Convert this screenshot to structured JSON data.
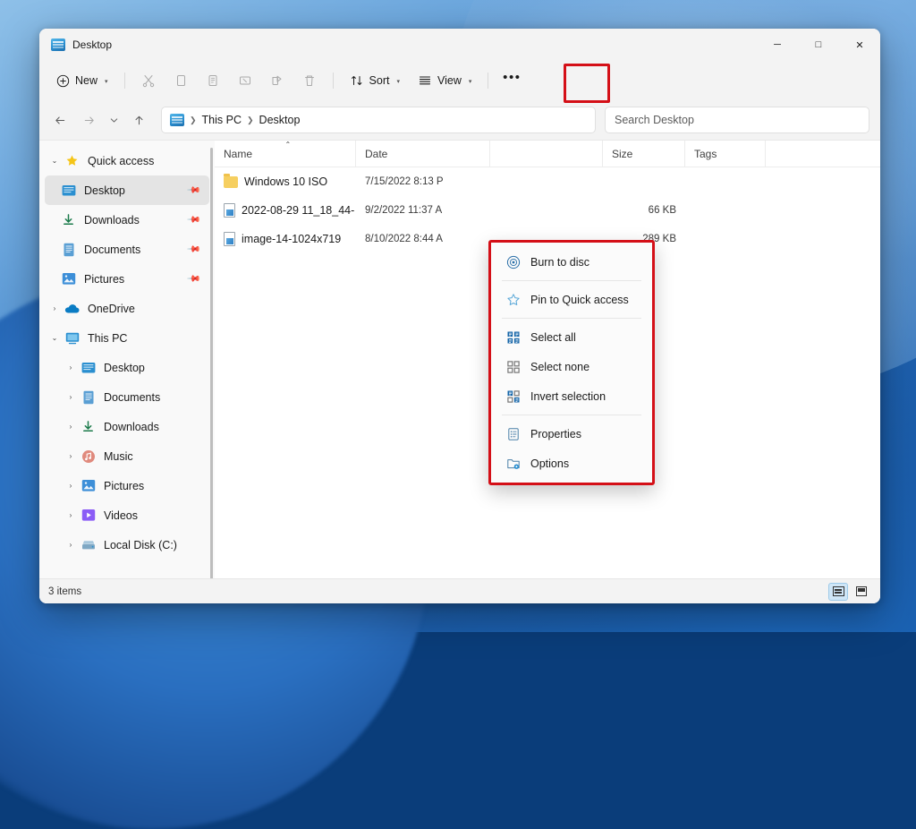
{
  "window": {
    "title": "Desktop",
    "title_icon": "desktop-icon",
    "controls": {
      "minimize": "─",
      "maximize": "□",
      "close": "✕"
    }
  },
  "toolbar": {
    "new_label": "New",
    "new_icon": "plus-circle-icon",
    "caret": "▾",
    "items": [
      {
        "name": "cut",
        "icon": "scissors-icon",
        "glyph": "✂"
      },
      {
        "name": "copy",
        "icon": "copy-icon",
        "glyph": "❐"
      },
      {
        "name": "paste",
        "icon": "paste-icon",
        "glyph": "Ὄb"
      },
      {
        "name": "rename",
        "icon": "rename-icon",
        "glyph": "✎"
      },
      {
        "name": "share",
        "icon": "share-icon",
        "glyph": "➦"
      },
      {
        "name": "delete",
        "icon": "trash-icon",
        "glyph": "Ὕ1"
      }
    ],
    "sort_label": "Sort",
    "sort_icon": "sort-arrows-icon",
    "view_label": "View",
    "view_icon": "view-lines-icon",
    "more_label": "•••",
    "more_icon": "see-more-ellipsis-icon"
  },
  "navigation": {
    "back_icon": "arrow-left-icon",
    "forward_icon": "arrow-right-icon",
    "recent_icon": "chevron-down-icon",
    "up_icon": "arrow-up-icon",
    "breadcrumb": [
      "This PC",
      "Desktop"
    ],
    "breadcrumb_separator": "❯",
    "breadcrumb_icon": "this-pc-icon"
  },
  "search": {
    "placeholder": "Search Desktop",
    "icon": "search-icon"
  },
  "sidebar": {
    "sections": [
      {
        "name": "quick-access",
        "label": "Quick access",
        "icon": "star-icon",
        "chevron": "⌄",
        "expanded": true,
        "items": [
          {
            "label": "Desktop",
            "icon": "desktop-icon",
            "pinned": true,
            "selected": true
          },
          {
            "label": "Downloads",
            "icon": "downloads-icon",
            "pinned": true,
            "selected": false
          },
          {
            "label": "Documents",
            "icon": "documents-icon",
            "pinned": true,
            "selected": false
          },
          {
            "label": "Pictures",
            "icon": "pictures-icon",
            "pinned": true,
            "selected": false
          }
        ]
      },
      {
        "name": "onedrive",
        "label": "OneDrive",
        "icon": "cloud-icon",
        "chevron": "›",
        "expanded": false,
        "items": []
      },
      {
        "name": "this-pc",
        "label": "This PC",
        "icon": "this-pc-icon",
        "chevron": "⌄",
        "expanded": true,
        "items": [
          {
            "label": "Desktop",
            "icon": "desktop-icon",
            "chevron": "›"
          },
          {
            "label": "Documents",
            "icon": "documents-icon",
            "chevron": "›"
          },
          {
            "label": "Downloads",
            "icon": "downloads-icon",
            "chevron": "›"
          },
          {
            "label": "Music",
            "icon": "music-icon",
            "chevron": "›"
          },
          {
            "label": "Pictures",
            "icon": "pictures-icon",
            "chevron": "›"
          },
          {
            "label": "Videos",
            "icon": "videos-icon",
            "chevron": "›"
          },
          {
            "label": "Local Disk (C:)",
            "icon": "drive-icon",
            "chevron": "›"
          }
        ]
      }
    ]
  },
  "filelist": {
    "columns": [
      {
        "key": "name",
        "label": "Name",
        "sorted": true,
        "sort_caret": "⌃"
      },
      {
        "key": "date",
        "label": "Date",
        "sorted": false
      },
      {
        "key": "type",
        "label": "",
        "sorted": false
      },
      {
        "key": "size",
        "label": "Size",
        "sorted": false
      },
      {
        "key": "tags",
        "label": "Tags",
        "sorted": false
      }
    ],
    "rows": [
      {
        "name": "Windows 10 ISO",
        "icon": "folder-icon",
        "date": "7/15/2022 8:13 P",
        "type": "",
        "size": "",
        "tags": ""
      },
      {
        "name": "2022-08-29 11_18_44-",
        "icon": "image-file-icon",
        "date": "9/2/2022 11:37 A",
        "type": "",
        "size": "66 KB",
        "tags": ""
      },
      {
        "name": "image-14-1024x719",
        "icon": "image-file-icon",
        "date": "8/10/2022 8:44 A",
        "type": "",
        "size": "289 KB",
        "tags": ""
      }
    ]
  },
  "statusbar": {
    "item_count": "3 items",
    "views": [
      {
        "name": "details-view",
        "icon": "details-view-icon",
        "active": true
      },
      {
        "name": "large-icons-view",
        "icon": "large-icons-view-icon",
        "active": false
      }
    ]
  },
  "context_menu": {
    "highlight_color": "#d40f17",
    "items": [
      {
        "label": "Burn to disc",
        "icon": "disc-icon",
        "separator_after": true
      },
      {
        "label": "Pin to Quick access",
        "icon": "star-outline-icon",
        "separator_after": true
      },
      {
        "label": "Select all",
        "icon": "select-all-icon",
        "separator_after": false
      },
      {
        "label": "Select none",
        "icon": "select-none-icon",
        "separator_after": false
      },
      {
        "label": "Invert selection",
        "icon": "invert-selection-icon",
        "separator_after": true
      },
      {
        "label": "Properties",
        "icon": "properties-icon",
        "separator_after": false
      },
      {
        "label": "Options",
        "icon": "options-folder-icon",
        "separator_after": false
      }
    ]
  }
}
